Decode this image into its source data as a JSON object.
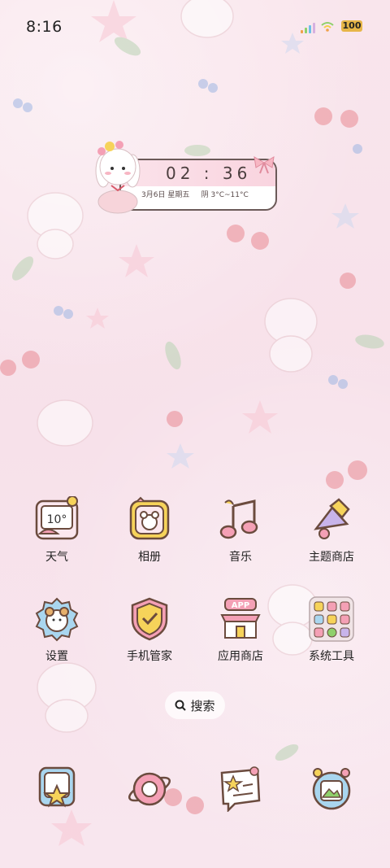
{
  "status_bar": {
    "time": "8:16",
    "battery": "100"
  },
  "clock_widget": {
    "time": "02 : 36",
    "date": "3月6日 星期五",
    "weather": "阴 3°C~11°C"
  },
  "apps": [
    {
      "label": "天气",
      "icon": "weather-icon",
      "badge": "10°"
    },
    {
      "label": "相册",
      "icon": "gallery-icon"
    },
    {
      "label": "音乐",
      "icon": "music-icon"
    },
    {
      "label": "主题商店",
      "icon": "theme-store-icon"
    },
    {
      "label": "设置",
      "icon": "settings-icon"
    },
    {
      "label": "手机管家",
      "icon": "phone-manager-icon"
    },
    {
      "label": "应用商店",
      "icon": "app-store-icon",
      "badge": "APP"
    },
    {
      "label": "系统工具",
      "icon": "system-tools-folder-icon"
    }
  ],
  "search": {
    "label": "搜索"
  },
  "dock": [
    {
      "icon": "dock-star-icon"
    },
    {
      "icon": "dock-planet-icon"
    },
    {
      "icon": "dock-note-icon"
    },
    {
      "icon": "dock-camera-icon"
    }
  ],
  "colors": {
    "background": "#f8e3ea",
    "accent_pink": "#f4a0b5",
    "outline": "#6b4b3e",
    "yellow": "#f6d35a",
    "blue": "#a9d6ef"
  }
}
